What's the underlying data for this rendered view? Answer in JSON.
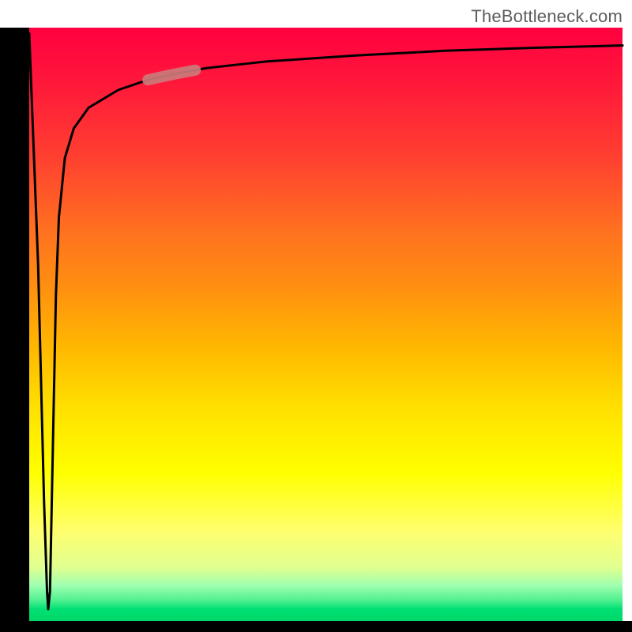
{
  "watermark": "TheBottleneck.com",
  "chart_data": {
    "type": "line",
    "title": "",
    "xlabel": "",
    "ylabel": "",
    "xlim": [
      0,
      100
    ],
    "ylim": [
      0,
      100
    ],
    "series": [
      {
        "name": "curve",
        "x": [
          0.0,
          1.5,
          2.5,
          3.0,
          3.2,
          3.5,
          4.0,
          4.5,
          5.0,
          6.0,
          7.5,
          10,
          15,
          20,
          25,
          30,
          40,
          55,
          70,
          85,
          100
        ],
        "y": [
          99,
          60,
          20,
          5,
          2,
          5,
          30,
          55,
          68,
          78,
          83,
          86.5,
          89.5,
          91.2,
          92.3,
          93.2,
          94.3,
          95.3,
          96.1,
          96.6,
          97.0
        ]
      }
    ],
    "annotations": [
      {
        "name": "highlight-segment",
        "x_range": [
          20,
          28
        ],
        "style": "thick-pink-stroke"
      }
    ],
    "background_gradient": {
      "direction": "vertical",
      "stops": [
        {
          "pos": 0.0,
          "color": "#ff0040"
        },
        {
          "pos": 0.22,
          "color": "#ff4030"
        },
        {
          "pos": 0.44,
          "color": "#ff9010"
        },
        {
          "pos": 0.64,
          "color": "#ffe000"
        },
        {
          "pos": 0.85,
          "color": "#ffff70"
        },
        {
          "pos": 0.96,
          "color": "#50f090"
        },
        {
          "pos": 1.0,
          "color": "#00d868"
        }
      ]
    }
  }
}
